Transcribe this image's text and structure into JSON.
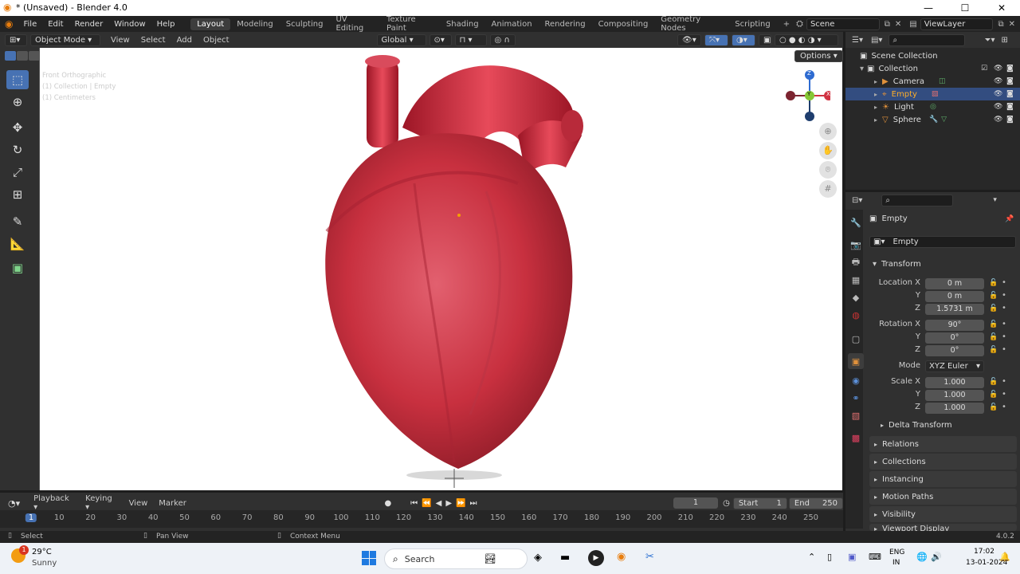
{
  "window": {
    "title": "* (Unsaved) - Blender 4.0",
    "controls": [
      "—",
      "☐",
      "✕"
    ]
  },
  "menus": [
    "File",
    "Edit",
    "Render",
    "Window",
    "Help"
  ],
  "workspaces": [
    "Layout",
    "Modeling",
    "Sculpting",
    "UV Editing",
    "Texture Paint",
    "Shading",
    "Animation",
    "Rendering",
    "Compositing",
    "Geometry Nodes",
    "Scripting",
    "+"
  ],
  "active_workspace": "Layout",
  "scene": "Scene",
  "view_layer": "ViewLayer",
  "viewport": {
    "mode": "Object Mode",
    "menus": [
      "View",
      "Select",
      "Add",
      "Object"
    ],
    "transform_orientation": "Global",
    "options_label": "Options",
    "overlay_text": [
      "Front Orthographic",
      "(1) Collection | Empty",
      "(1) Centimeters"
    ],
    "gizmo_axes": {
      "z": "Z",
      "y": "Y",
      "x": "X"
    }
  },
  "timeline": {
    "menus": [
      "Playback",
      "Keying",
      "View",
      "Marker"
    ],
    "current_frame": "1",
    "start_label": "Start",
    "start": "1",
    "end_label": "End",
    "end": "250",
    "ruler": [
      "1",
      "10",
      "20",
      "30",
      "40",
      "50",
      "60",
      "70",
      "80",
      "90",
      "100",
      "110",
      "120",
      "130",
      "140",
      "150",
      "160",
      "170",
      "180",
      "190",
      "200",
      "210",
      "220",
      "230",
      "240",
      "250"
    ]
  },
  "statusbar": {
    "select": "Select",
    "pan": "Pan View",
    "context": "Context Menu",
    "version": "4.0.2"
  },
  "outliner": {
    "root": "Scene Collection",
    "collection": "Collection",
    "items": [
      {
        "name": "Camera",
        "selected": false
      },
      {
        "name": "Empty",
        "selected": true
      },
      {
        "name": "Light",
        "selected": false
      },
      {
        "name": "Sphere",
        "selected": false
      }
    ]
  },
  "properties": {
    "object_name": "Empty",
    "datablock": "Empty",
    "transform_label": "Transform",
    "location_label": "Location X",
    "location": [
      "0 m",
      "0 m",
      "1.5731 m"
    ],
    "rotation_label": "Rotation X",
    "rotation": [
      "90°",
      "0°",
      "0°"
    ],
    "mode_label": "Mode",
    "mode_value": "XYZ Euler",
    "scale_label": "Scale X",
    "scale": [
      "1.000",
      "1.000",
      "1.000"
    ],
    "axis_y": "Y",
    "axis_z": "Z",
    "sections": [
      "Delta Transform",
      "Relations",
      "Collections",
      "Instancing",
      "Motion Paths",
      "Visibility",
      "Viewport Display"
    ]
  },
  "taskbar": {
    "weather_temp": "29°C",
    "weather_text": "Sunny",
    "notification_count": "1",
    "search_placeholder": "Search",
    "lang_top": "ENG",
    "lang_bottom": "IN",
    "time": "17:02",
    "date": "13-01-2024"
  },
  "colors": {
    "accent": "#4772b3",
    "selection": "#334d80",
    "heart_red": "#c8303f"
  }
}
